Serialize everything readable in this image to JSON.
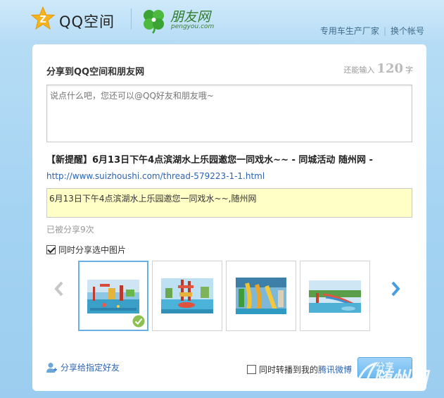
{
  "header": {
    "qzone_name": "QQ空间",
    "pengyou_name": "朋友网",
    "pengyou_domain": "pengyou.com",
    "links": [
      "专用车生产厂家",
      "换个帐号"
    ]
  },
  "share_panel": {
    "title": "分享到QQ空间和朋友网",
    "remain_prefix": "还能输入",
    "remain_count": "120",
    "remain_suffix": "字",
    "comment_placeholder": "说点什么吧，您还可以@QQ好友和朋友哦~",
    "page_title": "【新提醒】6月13日下午4点滨湖水上乐园邀您一同戏水~~ - 同城活动 随州网 -",
    "page_url": "http://www.suizhoushi.com/thread-579223-1-1.html",
    "description": "6月13日下午4点滨湖水上乐园邀您一同戏水~~,随州网",
    "share_count": "已被分享9次",
    "share_image_label": "同时分享选中图片",
    "share_image_checked": true,
    "images": [
      {
        "name": "waterpark-photo-1",
        "selected": true
      },
      {
        "name": "waterpark-photo-2",
        "selected": false
      },
      {
        "name": "waterpark-photo-3",
        "selected": false
      },
      {
        "name": "waterpark-photo-4",
        "selected": false
      }
    ]
  },
  "footer": {
    "share_to_friend": "分享给指定好友",
    "repost_prefix": "同时转播到我的",
    "repost_link": "腾讯微博",
    "share_button": "分享"
  },
  "watermark": "随州网",
  "colors": {
    "accent_blue": "#2d64b3",
    "highlight_yellow": "#ffffc6",
    "button_blue": "#6cb9f0",
    "selected_border": "#69aee4"
  }
}
